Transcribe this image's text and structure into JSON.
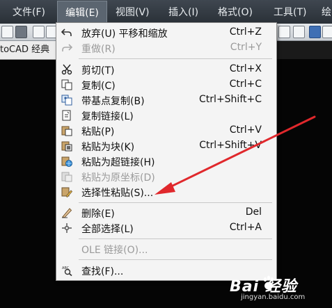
{
  "menubar": {
    "items": [
      {
        "label": "文件(F)"
      },
      {
        "label": "编辑(E)"
      },
      {
        "label": "视图(V)"
      },
      {
        "label": "插入(I)"
      },
      {
        "label": "格式(O)"
      },
      {
        "label": "工具(T)"
      },
      {
        "label": "绘"
      }
    ],
    "active_index": 1
  },
  "title_strip": {
    "text": "toCAD 经典"
  },
  "edit_menu": {
    "items": [
      {
        "label": "放弃(U) 平移和缩放",
        "shortcut": "Ctrl+Z",
        "icon": "undo-icon",
        "enabled": true
      },
      {
        "label": "重做(R)",
        "shortcut": "Ctrl+Y",
        "icon": "redo-icon",
        "enabled": false
      },
      {
        "label": "剪切(T)",
        "shortcut": "Ctrl+X",
        "icon": "scissors-icon",
        "enabled": true
      },
      {
        "label": "复制(C)",
        "shortcut": "Ctrl+C",
        "icon": "copy-icon",
        "enabled": true
      },
      {
        "label": "带基点复制(B)",
        "shortcut": "Ctrl+Shift+C",
        "icon": "copy-with-basepoint-icon",
        "enabled": true
      },
      {
        "label": "复制链接(L)",
        "shortcut": "",
        "icon": "copy-link-icon",
        "enabled": true
      },
      {
        "label": "粘贴(P)",
        "shortcut": "Ctrl+V",
        "icon": "paste-icon",
        "enabled": true
      },
      {
        "label": "粘贴为块(K)",
        "shortcut": "Ctrl+Shift+V",
        "icon": "paste-as-block-icon",
        "enabled": true
      },
      {
        "label": "粘贴为超链接(H)",
        "shortcut": "",
        "icon": "paste-hyperlink-icon",
        "enabled": true
      },
      {
        "label": "粘贴为原坐标(D)",
        "shortcut": "",
        "icon": "paste-original-coords-icon",
        "enabled": false
      },
      {
        "label": "选择性粘贴(S)...",
        "shortcut": "",
        "icon": "paste-special-icon",
        "enabled": true
      },
      {
        "label": "删除(E)",
        "shortcut": "Del",
        "icon": "eraser-icon",
        "enabled": true
      },
      {
        "label": "全部选择(L)",
        "shortcut": "Ctrl+A",
        "icon": "select-all-icon",
        "enabled": true
      },
      {
        "label": "OLE 链接(O)...",
        "shortcut": "",
        "icon": "",
        "enabled": false
      },
      {
        "label": "查找(F)...",
        "shortcut": "",
        "icon": "find-icon",
        "enabled": true
      }
    ]
  },
  "watermark": {
    "brand": "Bai  经验",
    "url": "jingyan.baidu.com",
    "icon": "baidu-paw-icon"
  },
  "annotation": {
    "type": "red-arrow",
    "target": "选择性粘贴(S)...",
    "color": "#e0282c"
  },
  "colors": {
    "menu_bg": "#f4f4f4",
    "menubar_bg": "#3a414a",
    "arrow": "#e0282c"
  }
}
